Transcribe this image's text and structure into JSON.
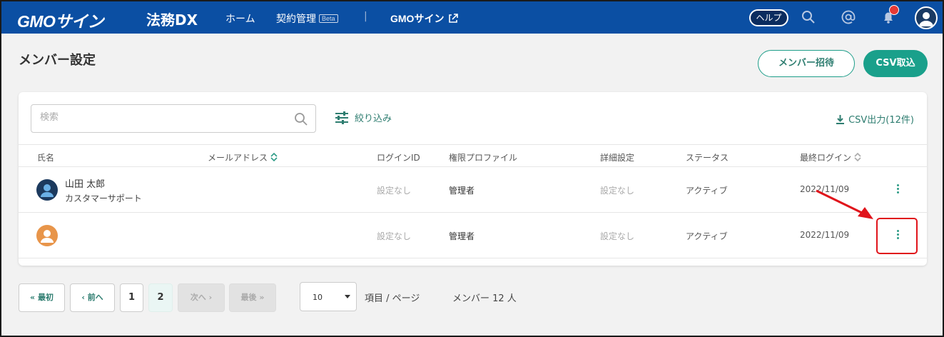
{
  "header": {
    "brand": "GMOサイン",
    "brand_sub": "法務DX",
    "nav_home": "ホーム",
    "nav_contract": "契約管理",
    "beta": "Beta",
    "separator": "|",
    "nav_gmo": "GMOサイン",
    "help": "ヘルプ",
    "notification_dot_color": "#e53935"
  },
  "page": {
    "title": "メンバー設定",
    "invite_button": "メンバー招待",
    "csv_import_button": "CSV取込"
  },
  "toolbar": {
    "search_placeholder": "検索",
    "filter_label": "絞り込み",
    "csv_export_label": "CSV出力(12件)"
  },
  "table": {
    "headers": {
      "name": "氏名",
      "email": "メールアドレス",
      "login_id": "ログインID",
      "profile": "権限プロファイル",
      "detail": "詳細設定",
      "status": "ステータス",
      "last_login": "最終ログイン"
    },
    "rows": [
      {
        "name": "山田 太郎",
        "dept": "カスタマーサポート",
        "login_id": "設定なし",
        "profile": "管理者",
        "detail": "設定なし",
        "status": "アクティブ",
        "last_login": "2022/11/09",
        "avatar_color": "#1c3a5e"
      },
      {
        "name": "",
        "dept": "",
        "login_id": "設定なし",
        "profile": "管理者",
        "detail": "設定なし",
        "status": "アクティブ",
        "last_login": "2022/11/09",
        "avatar_color": "#e8954a"
      }
    ]
  },
  "pagination": {
    "first": "最初",
    "prev": "前へ",
    "page1": "1",
    "page2": "2",
    "next": "次へ",
    "last": "最後",
    "per_page_value": "10",
    "per_page_label": "項目 / ページ",
    "member_count": "メンバー 12 人"
  },
  "colors": {
    "header_bg": "#0b4fa3",
    "accent": "#1aa08b",
    "highlight": "#e0141b"
  }
}
